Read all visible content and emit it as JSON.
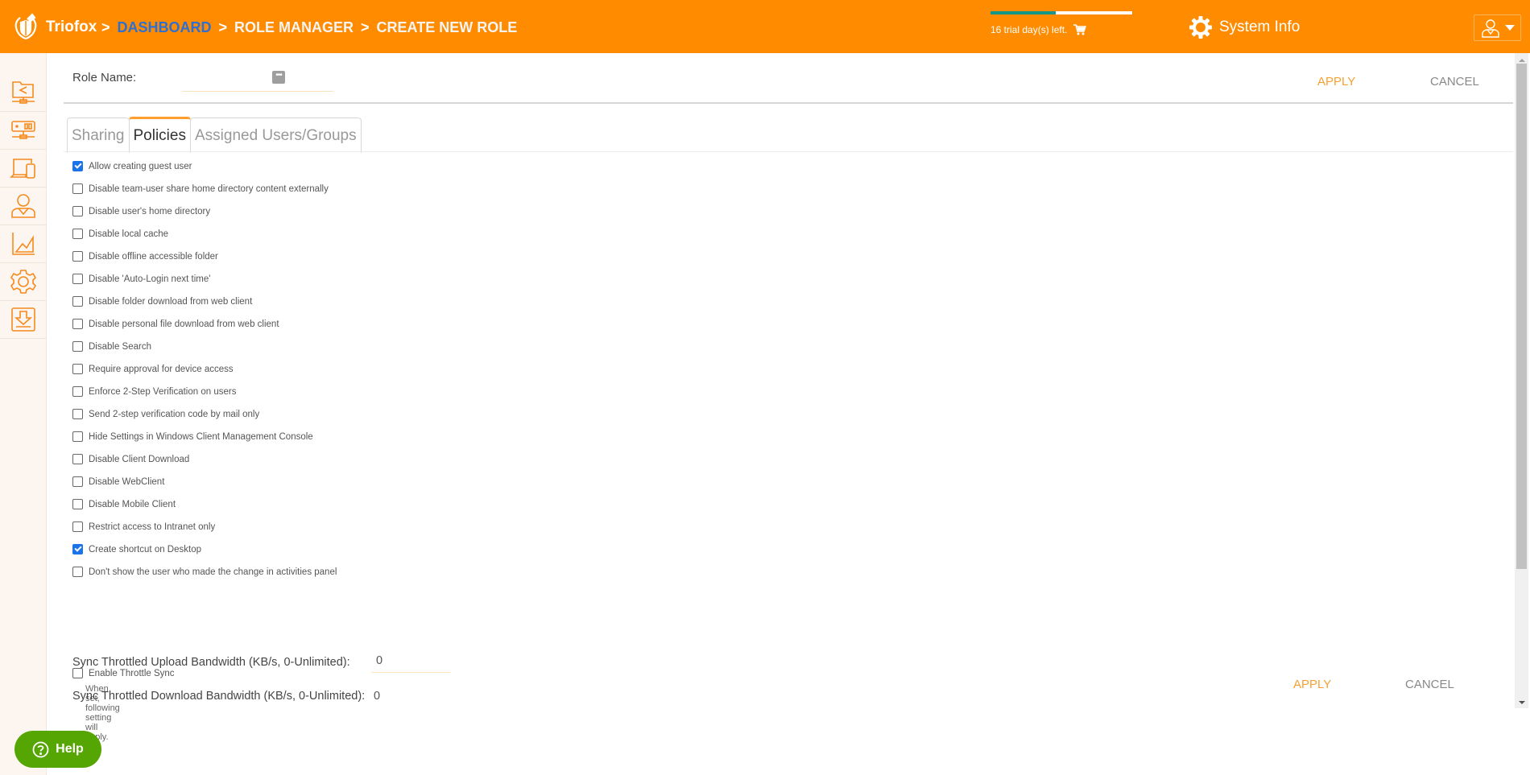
{
  "header": {
    "brand": "Triofox",
    "breadcrumb": [
      {
        "label": "DASHBOARD",
        "link": true
      },
      {
        "label": "ROLE MANAGER",
        "link": false
      },
      {
        "label": "CREATE NEW ROLE",
        "link": false
      }
    ],
    "separator": ">",
    "trial_text": "16 trial day(s) left.",
    "trial_progress": 0.46,
    "system_info_label": "System Info",
    "icons": {
      "logo": "shield-logo-icon",
      "cart": "cart-icon",
      "system": "gear-icon",
      "user": "user-icon",
      "caret": "caret-down-icon"
    }
  },
  "sidebar": {
    "items": [
      {
        "name": "shared-folder",
        "icon": "folder-share-icon"
      },
      {
        "name": "storage",
        "icon": "server-network-icon"
      },
      {
        "name": "devices",
        "icon": "devices-icon"
      },
      {
        "name": "users",
        "icon": "user-icon"
      },
      {
        "name": "reports",
        "icon": "chart-icon"
      },
      {
        "name": "settings",
        "icon": "gear-icon"
      },
      {
        "name": "downloads",
        "icon": "download-icon"
      }
    ]
  },
  "form": {
    "role_name_label": "Role Name:",
    "role_name_value": "",
    "more_button": "•••",
    "apply_label": "APPLY",
    "cancel_label": "CANCEL"
  },
  "tabs": [
    {
      "label": "Sharing",
      "active": false
    },
    {
      "label": "Policies",
      "active": true
    },
    {
      "label": "Assigned Users/Groups",
      "active": false
    }
  ],
  "policies": [
    {
      "label": "Allow creating guest user",
      "checked": true
    },
    {
      "label": "Disable team-user share home directory content externally",
      "checked": false
    },
    {
      "label": "Disable user's home directory",
      "checked": false
    },
    {
      "label": "Disable local cache",
      "checked": false
    },
    {
      "label": "Disable offline accessible folder",
      "checked": false
    },
    {
      "label": "Disable 'Auto-Login next time'",
      "checked": false
    },
    {
      "label": "Disable folder download from web client",
      "checked": false
    },
    {
      "label": "Disable personal file download from web client",
      "checked": false
    },
    {
      "label": "Disable Search",
      "checked": false
    },
    {
      "label": "Require approval for device access",
      "checked": false
    },
    {
      "label": "Enforce 2-Step Verification on users",
      "checked": false
    },
    {
      "label": "Send 2-step verification code by mail only",
      "checked": false
    },
    {
      "label": "Hide Settings in Windows Client Management Console",
      "checked": false
    },
    {
      "label": "Disable Client Download",
      "checked": false
    },
    {
      "label": "Disable WebClient",
      "checked": false
    },
    {
      "label": "Disable Mobile Client",
      "checked": false
    },
    {
      "label": "Restrict access to Intranet only",
      "checked": false
    },
    {
      "label": "Create shortcut on Desktop",
      "checked": true
    },
    {
      "label": "Don't show the user who made the change in activities panel",
      "checked": false
    }
  ],
  "throttle": {
    "label": "Enable Throttle Sync",
    "checked": false,
    "hint": "When set, following setting will apply.",
    "upload_label": "Sync Throttled Upload Bandwidth (KB/s, 0-Unlimited):",
    "upload_value": "0",
    "download_label": "Sync Throttled Download Bandwidth (KB/s, 0-Unlimited):",
    "download_value": "0"
  },
  "help": {
    "label": "Help",
    "icon": "question-circle-icon"
  }
}
